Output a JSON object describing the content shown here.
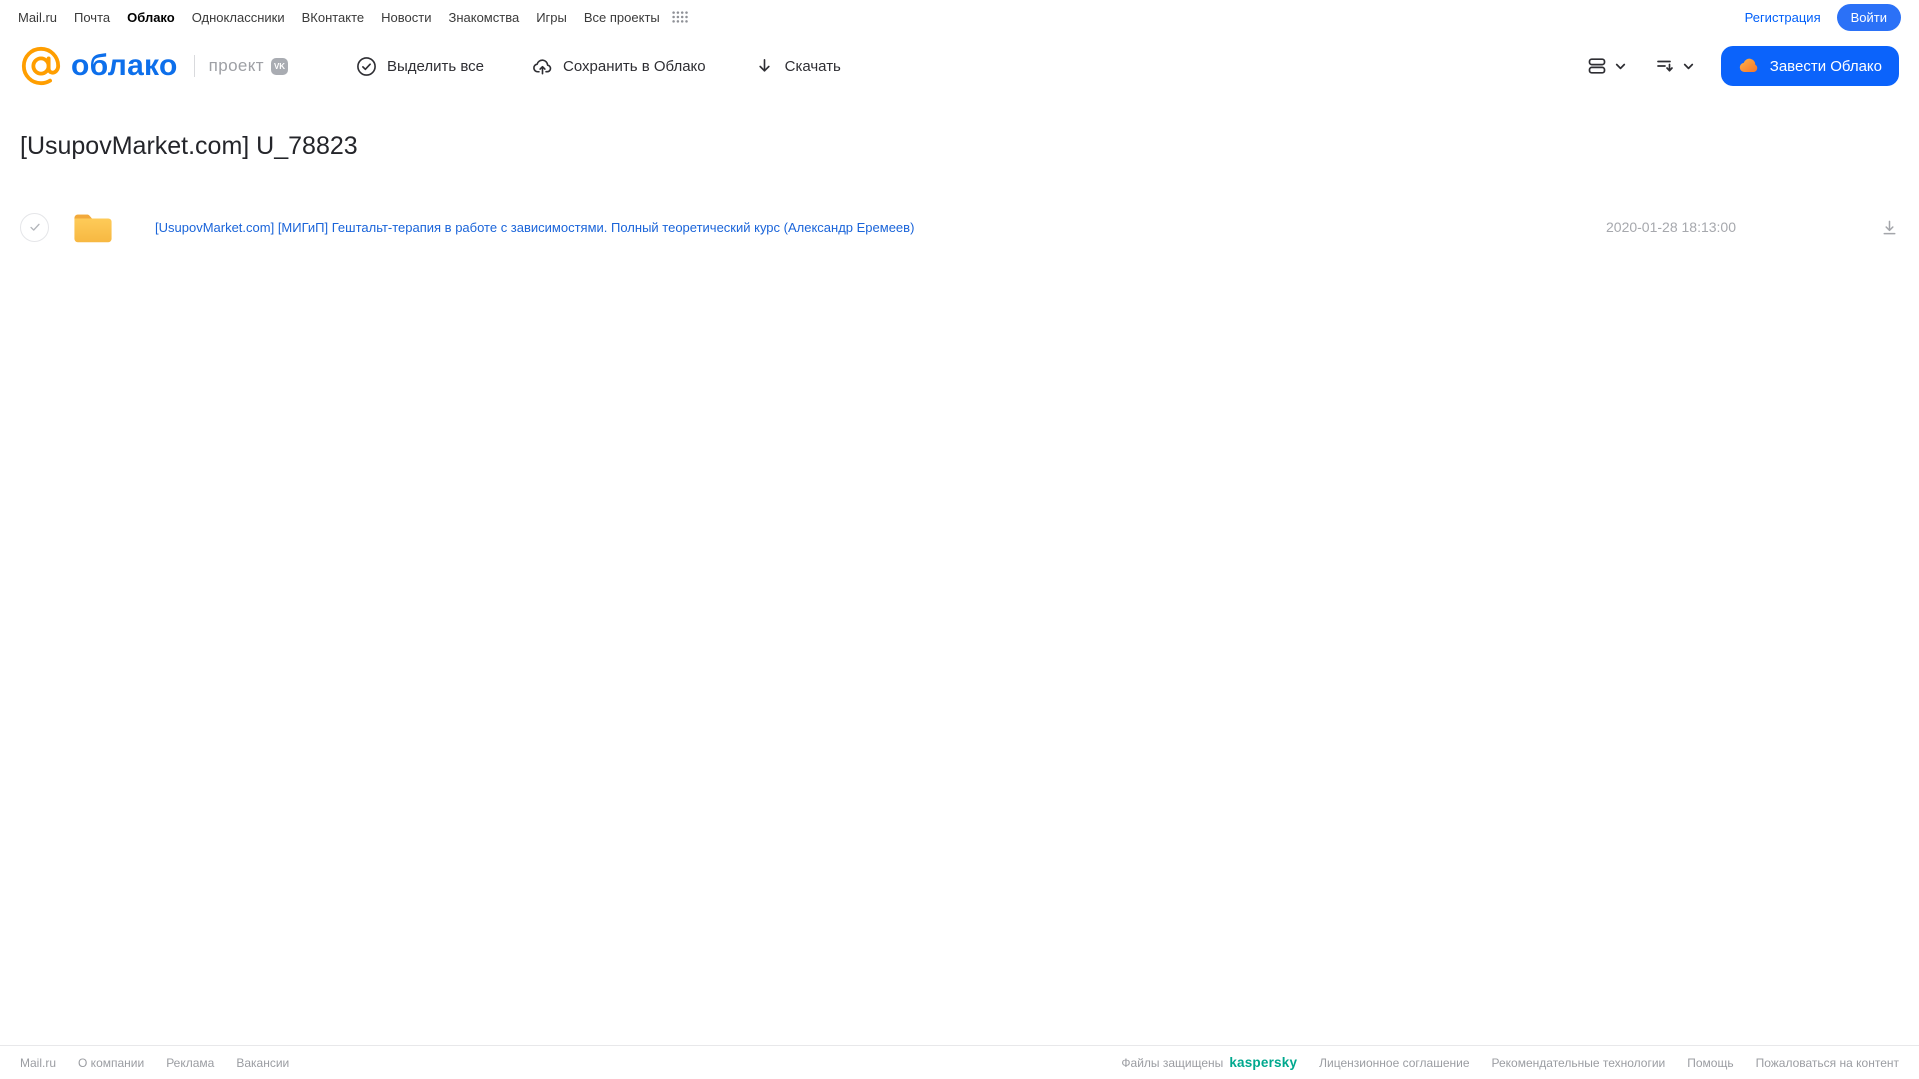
{
  "portal_nav": {
    "items": [
      "Mail.ru",
      "Почта",
      "Облако",
      "Одноклассники",
      "ВКонтакте",
      "Новости",
      "Знакомства",
      "Игры",
      "Все проекты"
    ],
    "active_item": "Облако",
    "registration_label": "Регистрация",
    "login_label": "Войти"
  },
  "header": {
    "logo_text": "облако",
    "project_label": "проект",
    "vk_badge": "VK",
    "toolbar": {
      "select_all_label": "Выделить все",
      "save_to_cloud_label": "Сохранить в Облако",
      "download_label": "Скачать"
    },
    "get_cloud_label": "Завести Облако"
  },
  "main": {
    "title": "[UsupovMarket.com] U_78823",
    "files": [
      {
        "name": "[UsupovMarket.com] [МИГиП] Гештальт-терапия в работе с зависимостями. Полный теоретический курс (Александр Еремеев)",
        "date": "2020-01-28 18:13:00",
        "type": "folder"
      }
    ]
  },
  "footer": {
    "left_links": [
      "Mail.ru",
      "О компании",
      "Реклама",
      "Вакансии"
    ],
    "protected_text": "Файлы защищены",
    "kaspersky_label": "kaspersky",
    "right_links": [
      "Лицензионное соглашение",
      "Рекомендательные технологии",
      "Помощь",
      "Пожаловаться на контент"
    ]
  },
  "icons": {
    "all_projects": "grid-dots",
    "select_all": "check-circle",
    "save_to_cloud": "cloud-upload-arrow",
    "download": "arrow-down",
    "view_mode": "list-rows",
    "sort": "sort-lines-arrow-down",
    "chevron": "chevron-down",
    "get_cloud": "orange-cloud",
    "file_folder": "yellow-folder",
    "row_download": "arrow-down-underline",
    "logo_at": "orange-at-sign",
    "vk": "vk-badge"
  },
  "colors": {
    "accent_blue": "#005FF9",
    "button_blue": "#0B63FB",
    "file_link_blue": "#1A64D9",
    "logo_blue": "#0D6FEB",
    "logo_orange": "#FF9E00",
    "kaspersky_green": "#00A88E",
    "folder_yellow": "#FFC94F",
    "folder_tab_orange": "#F2A93B",
    "muted_gray": "#9B9DA2"
  }
}
